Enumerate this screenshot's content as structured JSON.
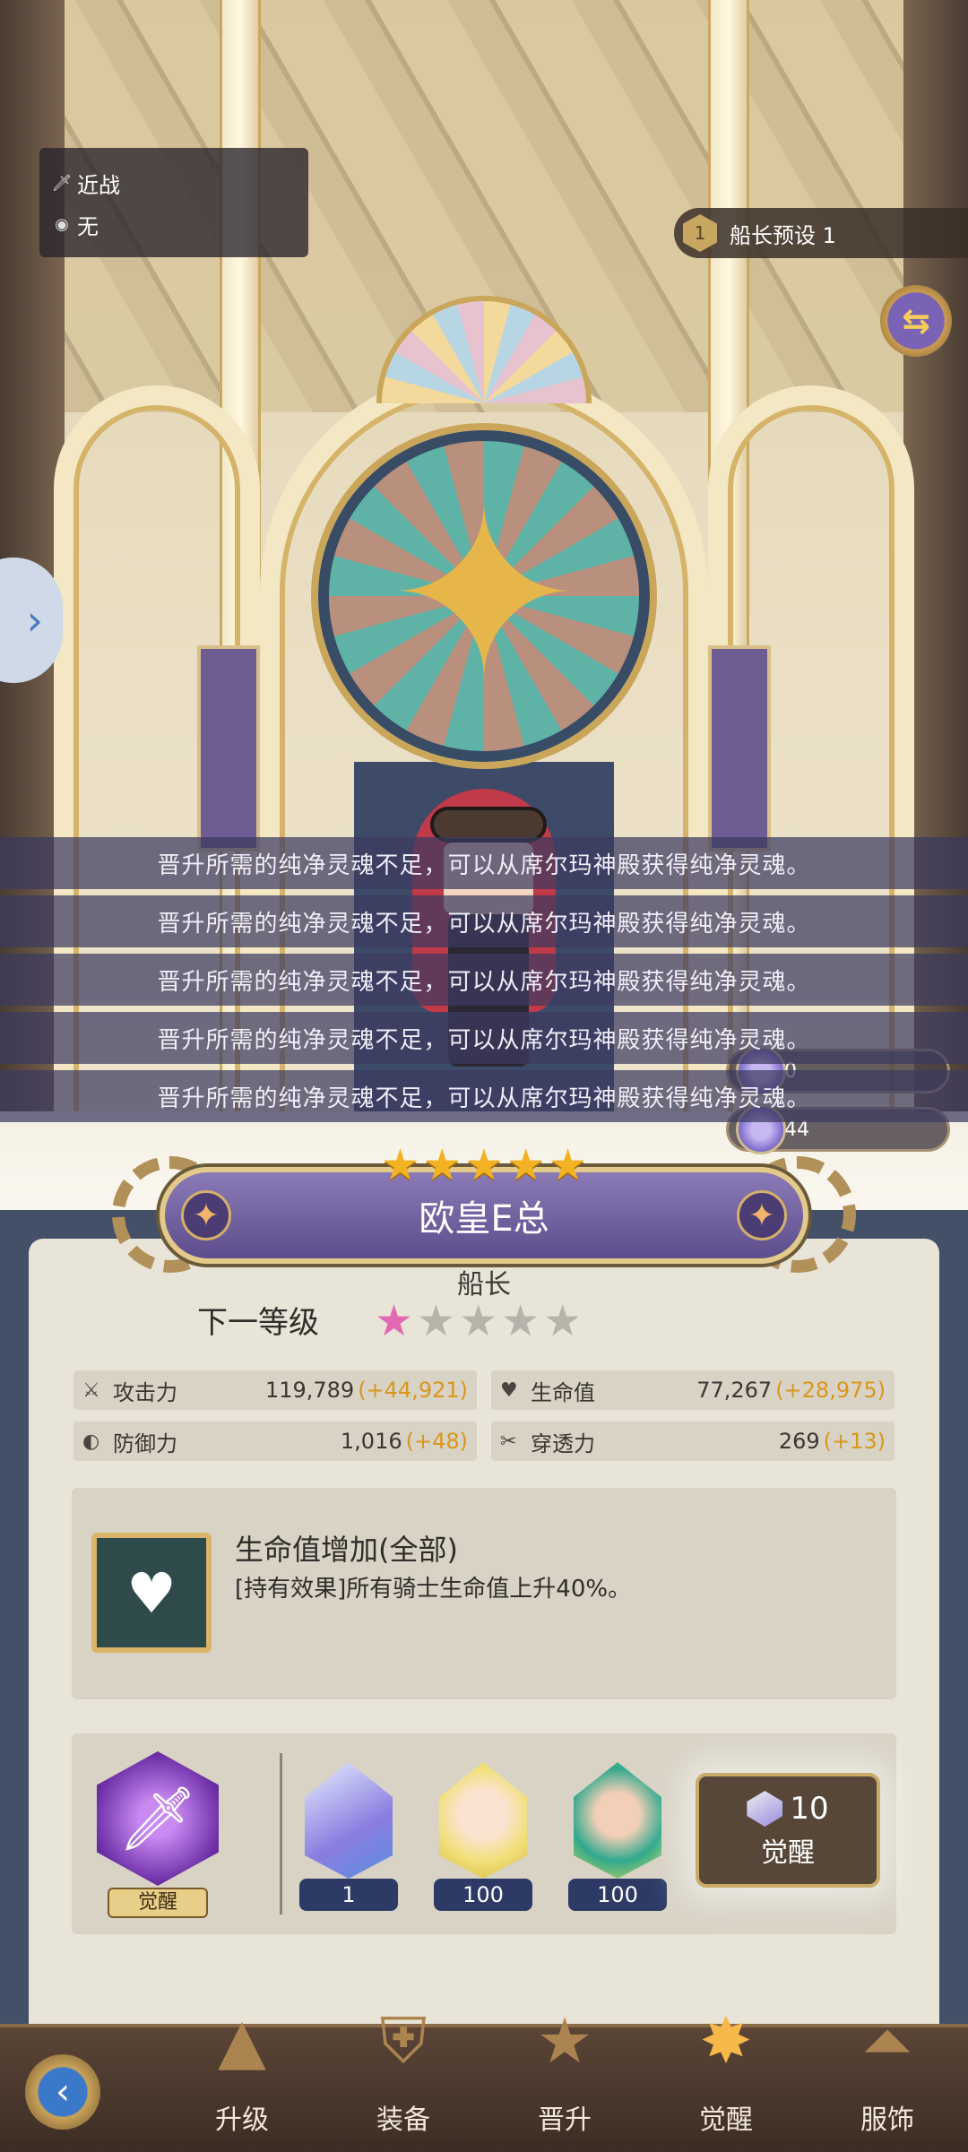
{
  "scene": {
    "info": {
      "attack_type": "近战",
      "attribute": "无"
    },
    "preset": {
      "number": "1",
      "label": "船长预设 1"
    },
    "swap_icon": "swap-arrows-icon",
    "side_arrow": "›",
    "toasts": [
      "晋升所需的纯净灵魂不足，可以从席尔玛神殿获得纯净灵魂。",
      "晋升所需的纯净灵魂不足，可以从席尔玛神殿获得纯净灵魂。",
      "晋升所需的纯净灵魂不足，可以从席尔玛神殿获得纯净灵魂。",
      "晋升所需的纯净灵魂不足，可以从席尔玛神殿获得纯净灵魂。",
      "晋升所需的纯净灵魂不足，可以从席尔玛神殿获得纯净灵魂。"
    ],
    "currencies": [
      {
        "icon": "soul-gem-icon",
        "value": "0"
      },
      {
        "icon": "crystal-gem-icon",
        "value": "44"
      }
    ]
  },
  "hero": {
    "stars": 5,
    "name": "欧皇E总",
    "role": "船长",
    "next_level_label": "下一等级",
    "next_level_stars_filled": 1,
    "next_level_stars_total": 5
  },
  "stats": {
    "attack": {
      "label": "攻击力",
      "value": "119,789",
      "bonus": "(+44,921)"
    },
    "hp": {
      "label": "生命值",
      "value": "77,267",
      "bonus": "(+28,975)"
    },
    "defense": {
      "label": "防御力",
      "value": "1,016",
      "bonus": "(+48)"
    },
    "penetration": {
      "label": "穿透力",
      "value": "269",
      "bonus": "(+13)"
    }
  },
  "effect": {
    "title": "生命值增加(全部)",
    "description": "[持有效果]所有骑士生命值上升40%。"
  },
  "awaken": {
    "badge_label": "觉醒",
    "materials": [
      {
        "icon": "crystal-material-icon",
        "count": "1"
      },
      {
        "icon": "blonde-hero-portrait-icon",
        "count": "100"
      },
      {
        "icon": "green-hair-hero-portrait-icon",
        "count": "100"
      }
    ],
    "button_cost": "10",
    "button_label": "觉醒"
  },
  "nav": {
    "items": [
      {
        "label": "升级",
        "icon": "upgrade-icon"
      },
      {
        "label": "装备",
        "icon": "equipment-shield-icon"
      },
      {
        "label": "晋升",
        "icon": "promotion-star-icon"
      },
      {
        "label": "觉醒",
        "icon": "awaken-star-icon",
        "active": true
      },
      {
        "label": "服饰",
        "icon": "costume-hanger-icon"
      }
    ]
  },
  "colors": {
    "bonus": "#d9971c",
    "panel_bg": "#e8e4d8",
    "name_plate": "#6d5d9c",
    "active_nav": "#f7b84a"
  }
}
